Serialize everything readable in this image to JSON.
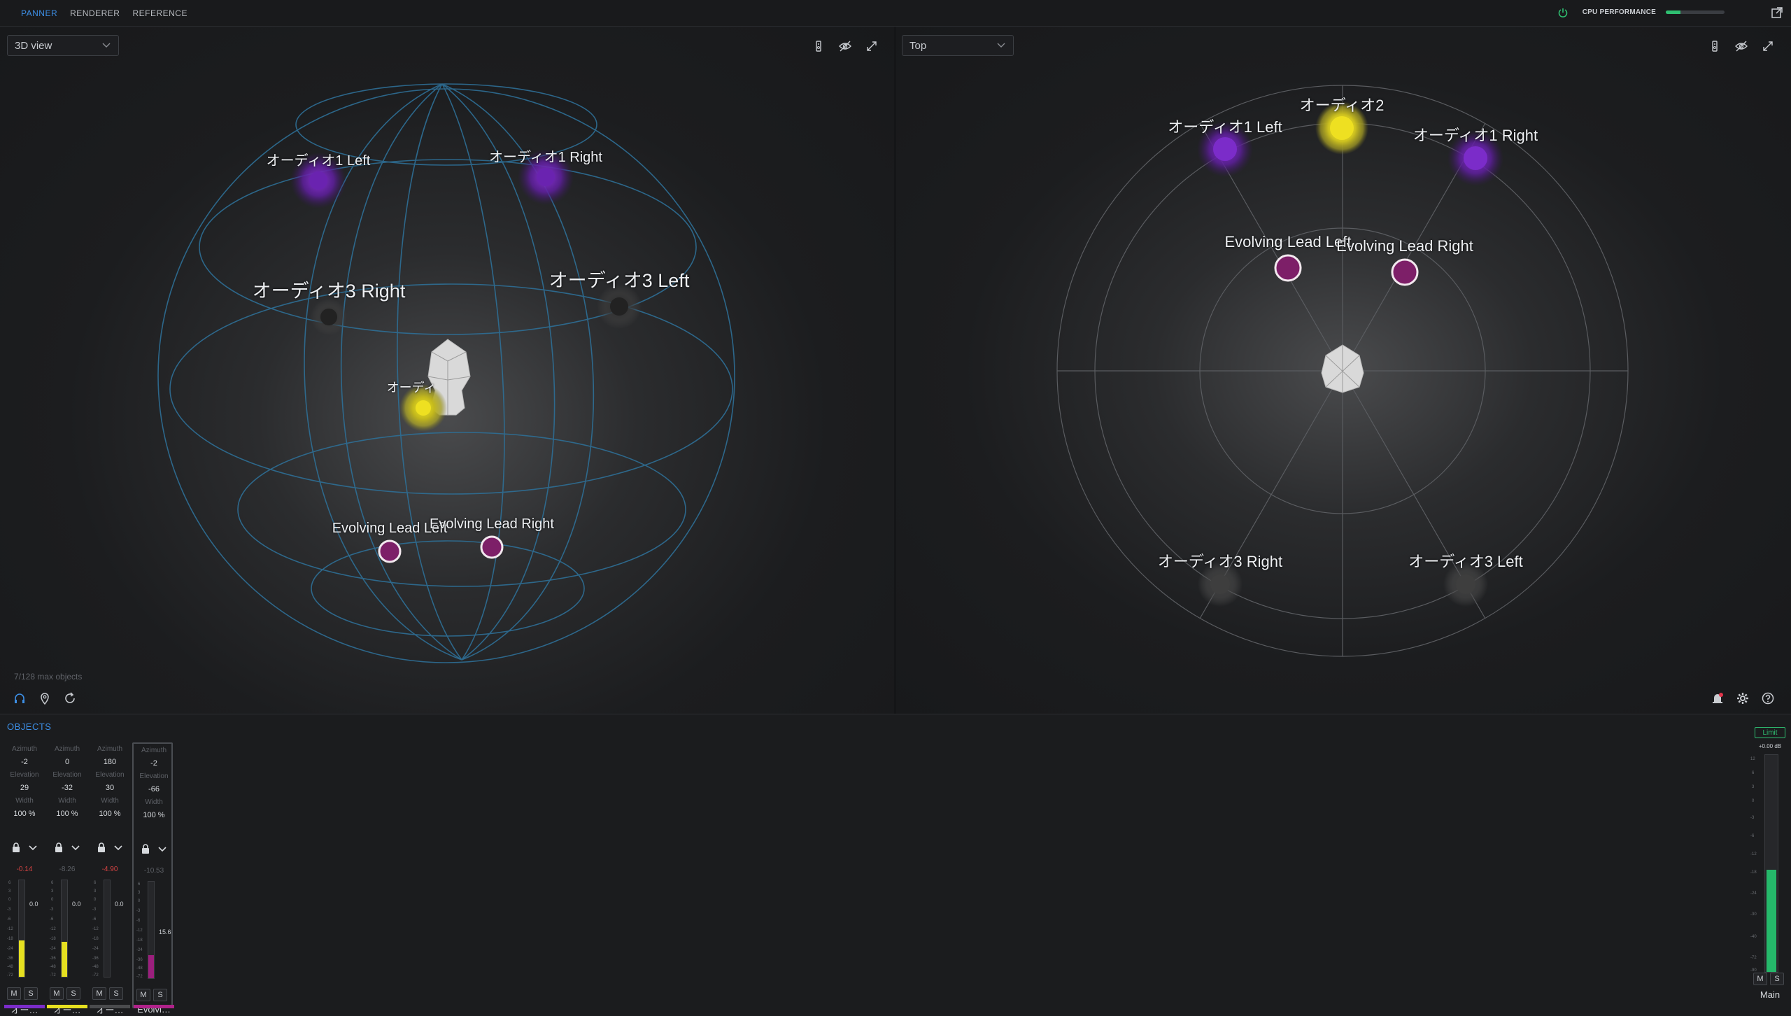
{
  "tabs": [
    {
      "label": "PANNER",
      "active": true
    },
    {
      "label": "RENDERER",
      "active": false
    },
    {
      "label": "REFERENCE",
      "active": false
    }
  ],
  "cpu": {
    "label": "CPU PERFORMANCE",
    "level_percent": 25
  },
  "colors": {
    "accent": "#3d8fe6",
    "purple": "#7b2cc9",
    "yellow": "#e6e020",
    "magenta": "#9b1f7d",
    "green": "#2fbf71"
  },
  "left_view": {
    "dropdown": "3D view",
    "max_objects": "7/128 max objects",
    "labels": {
      "ch1_left": "オーディオ1 Left",
      "ch1_right": "オーディオ1 Right",
      "ch3_right": "オーディオ3 Right",
      "ch3_left": "オーディオ3 Left",
      "ch2": "オーディ",
      "lead_left": "Evolving Lead Left",
      "lead_right": "Evolving Lead Right"
    }
  },
  "right_view": {
    "dropdown": "Top",
    "labels": {
      "ch2": "オーディオ2",
      "ch1_left": "オーディオ1 Left",
      "ch1_right": "オーディオ1 Right",
      "lead_left": "Evolving Lead Left",
      "lead_right": "Evolving Lead Right",
      "ch3_right": "オーディオ3 Right",
      "ch3_left": "オーディオ3 Left"
    }
  },
  "objects": {
    "title": "OBJECTS",
    "param_labels": {
      "azimuth": "Azimuth",
      "elevation": "Elevation",
      "width": "Width"
    },
    "strips": [
      {
        "azimuth": "-2",
        "elevation": "29",
        "width": "100 %",
        "peak": "-0.14",
        "fader": "0.0",
        "level_percent": 38,
        "meter_color": "#e6e020",
        "mute": "M",
        "solo": "S",
        "name": "オー…",
        "color": "#7b2cc9"
      },
      {
        "azimuth": "0",
        "elevation": "-32",
        "width": "100 %",
        "peak": "-8.26",
        "fader": "0.0",
        "level_percent": 36,
        "meter_color": "#e6e020",
        "mute": "M",
        "solo": "S",
        "name": "オー…",
        "color": "#e6e020"
      },
      {
        "azimuth": "180",
        "elevation": "30",
        "width": "100 %",
        "peak": "-4.90",
        "fader": "0.0",
        "level_percent": 0,
        "meter_color": "#e6e020",
        "mute": "M",
        "solo": "S",
        "name": "オー…",
        "color": "#4a4b4d"
      },
      {
        "azimuth": "-2",
        "elevation": "-66",
        "width": "100 %",
        "peak": "-10.53",
        "fader": "15.6",
        "level_percent": 24,
        "meter_color": "#9b1f7d",
        "mute": "M",
        "solo": "S",
        "name": "Evolvi…",
        "color": "#b0228a"
      }
    ]
  },
  "main_bus": {
    "limit": "Limit",
    "db": "+0.00 dB",
    "level_percent": 47,
    "mute": "M",
    "solo": "S",
    "name": "Main"
  }
}
